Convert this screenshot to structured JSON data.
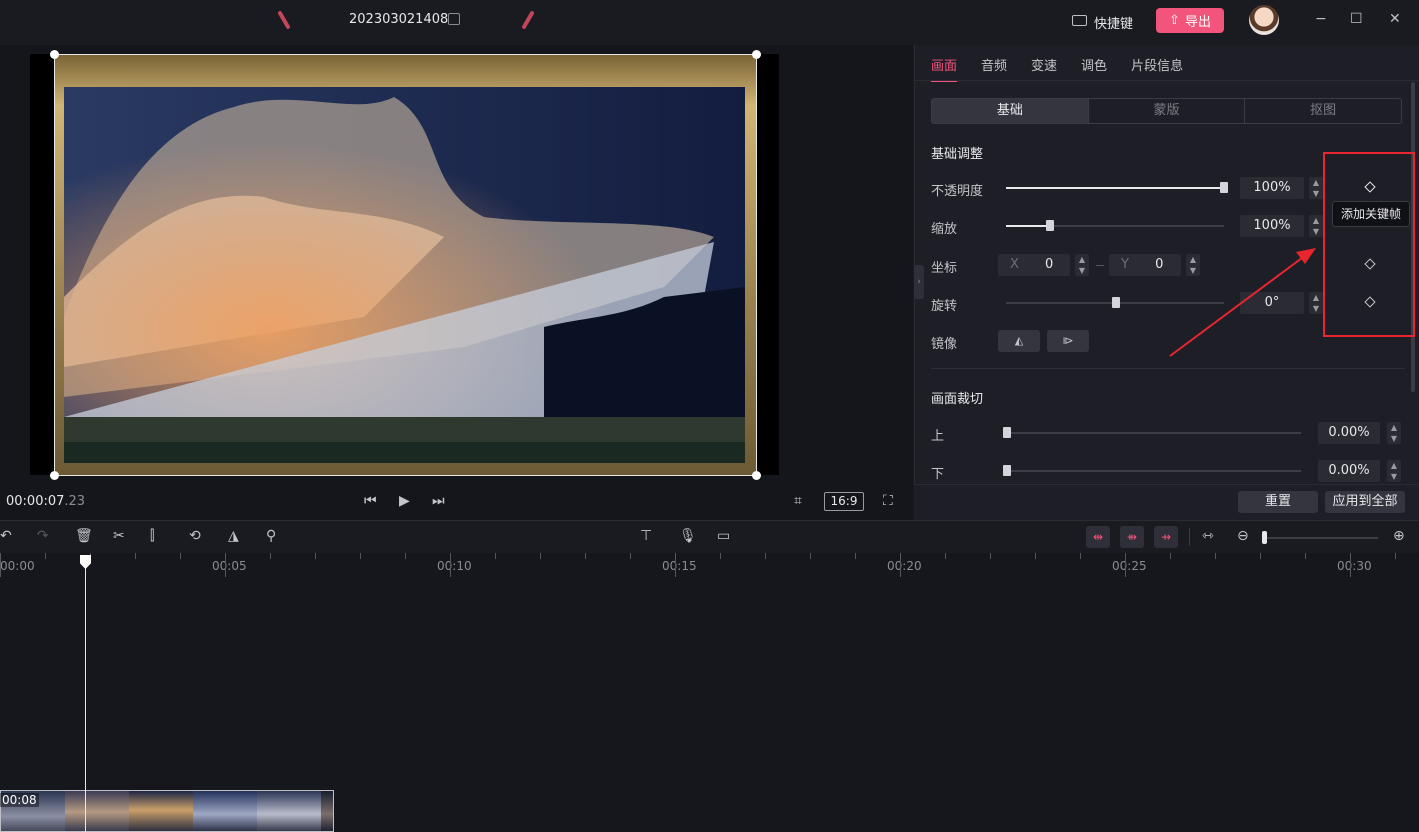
{
  "titlebar": {
    "project_title": "202303021408",
    "shortcut_label": "快捷键",
    "export_label": "导出",
    "minimize": "−",
    "maximize": "☐",
    "close": "✕"
  },
  "preview": {
    "time_current": "00:00:07",
    "time_frames": ".23",
    "aspect_ratio": "16:9"
  },
  "panel": {
    "tabs": [
      {
        "label": "画面",
        "active": true
      },
      {
        "label": "音频",
        "active": false
      },
      {
        "label": "变速",
        "active": false
      },
      {
        "label": "调色",
        "active": false
      },
      {
        "label": "片段信息",
        "active": false
      }
    ],
    "segments": [
      {
        "label": "基础",
        "active": true
      },
      {
        "label": "蒙版",
        "active": false
      },
      {
        "label": "抠图",
        "active": false
      }
    ],
    "basic_title": "基础调整",
    "opacity": {
      "label": "不透明度",
      "value": "100%",
      "level": 1.0
    },
    "scale": {
      "label": "缩放",
      "value": "100%",
      "level": 0.2
    },
    "position": {
      "label": "坐标",
      "x_label": "X",
      "x_value": "0",
      "y_label": "Y",
      "y_value": "0"
    },
    "rotation": {
      "label": "旋转",
      "value": "0°",
      "level": 0.5
    },
    "mirror": {
      "label": "镜像"
    },
    "keyframe_tooltip": "添加关键帧",
    "crop_title": "画面裁切",
    "crop_top": {
      "label": "上",
      "value": "0.00%",
      "level": 0
    },
    "crop_bottom": {
      "label": "下",
      "value": "0.00%",
      "level": 0
    },
    "reset_label": "重置",
    "apply_all_label": "应用到全部"
  },
  "timeline": {
    "ruler": [
      "00:00",
      "00:05",
      "00:10",
      "00:15",
      "00:20",
      "00:25",
      "00:30"
    ],
    "clip_duration": "00:08"
  },
  "colors": {
    "accent": "#f2547b",
    "annotation_red": "#e8262f"
  }
}
